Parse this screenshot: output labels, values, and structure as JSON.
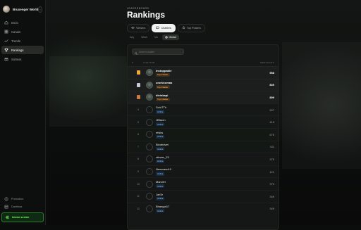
{
  "app": {
    "name": "Bruxenger World",
    "collapse_icon": "chevron-left-icon"
  },
  "sidebar": {
    "items": [
      {
        "label": "Inicio",
        "icon": "home-icon"
      },
      {
        "label": "Canais",
        "icon": "grid-icon"
      },
      {
        "label": "Trends",
        "icon": "trend-icon"
      },
      {
        "label": "Rankings",
        "icon": "trophy-icon",
        "active": true
      },
      {
        "label": "Sorteos",
        "icon": "gift-icon"
      }
    ],
    "bottom": [
      {
        "label": "Promotion",
        "icon": "info-icon"
      },
      {
        "label": "Dashboa",
        "icon": "layout-icon"
      }
    ],
    "login_label": "Iniciar sesión"
  },
  "header": {
    "breadcrumb": "LEADERBOARD",
    "title": "Rankings"
  },
  "tabs": [
    {
      "label": "Viewers",
      "icon": "eye-icon"
    },
    {
      "label": "Chatters",
      "icon": "chat-icon",
      "active": true
    },
    {
      "label": "Top Posters",
      "icon": "star-icon"
    }
  ],
  "periods": [
    {
      "label": "Day"
    },
    {
      "label": "Week"
    },
    {
      "label": "Mo"
    },
    {
      "label": "Global",
      "icon": "globe-icon",
      "active": true
    }
  ],
  "table": {
    "search_placeholder": "Search chatter",
    "col_position": "#",
    "col_user": "CHATTER",
    "col_score": "MESSAGES",
    "rows": [
      {
        "pos": "1",
        "name": "Instoppable",
        "badge": "Top Chatter",
        "badge_type": "top",
        "score": "958",
        "medal_color": "#f0a93a"
      },
      {
        "pos": "2",
        "name": "unchicomas",
        "badge": "Top Chatter",
        "badge_type": "top",
        "score": "849",
        "medal_color": "#c5ccd6"
      },
      {
        "pos": "3",
        "name": "divinkapi",
        "badge": "Top Chatter",
        "badge_type": "top",
        "score": "899",
        "medal_color": "#c97a45"
      },
      {
        "pos": "4",
        "name": "SoluTTh",
        "badge": "Active",
        "badge_type": "active",
        "score": "507"
      },
      {
        "pos": "5",
        "name": "JBfacrn",
        "badge": "Active",
        "badge_type": "active",
        "score": "419"
      },
      {
        "pos": "6",
        "name": "efsiks",
        "badge": "Active",
        "badge_type": "active",
        "score": "675"
      },
      {
        "pos": "7",
        "name": "Biodedvet",
        "badge": "Active",
        "badge_type": "active",
        "score": "411"
      },
      {
        "pos": "8",
        "name": "cthvter_23",
        "badge": "Active",
        "badge_type": "active",
        "score": "375"
      },
      {
        "pos": "9",
        "name": "Nesccaso10",
        "badge": "Active",
        "badge_type": "active",
        "score": "121"
      },
      {
        "pos": "10",
        "name": "Marcrtrt",
        "badge": "Active",
        "badge_type": "active",
        "score": "379"
      },
      {
        "pos": "11",
        "name": "Jarl3r",
        "badge": "Active",
        "badge_type": "active",
        "score": "349"
      },
      {
        "pos": "12",
        "name": "Bhangot17",
        "badge": "Active",
        "badge_type": "active",
        "score": "349"
      }
    ]
  },
  "colors": {
    "accent_green": "#7dff5a",
    "badge_top": "#ff9d3a",
    "badge_active": "#6fb4ff",
    "background": "#0b0d0c"
  }
}
